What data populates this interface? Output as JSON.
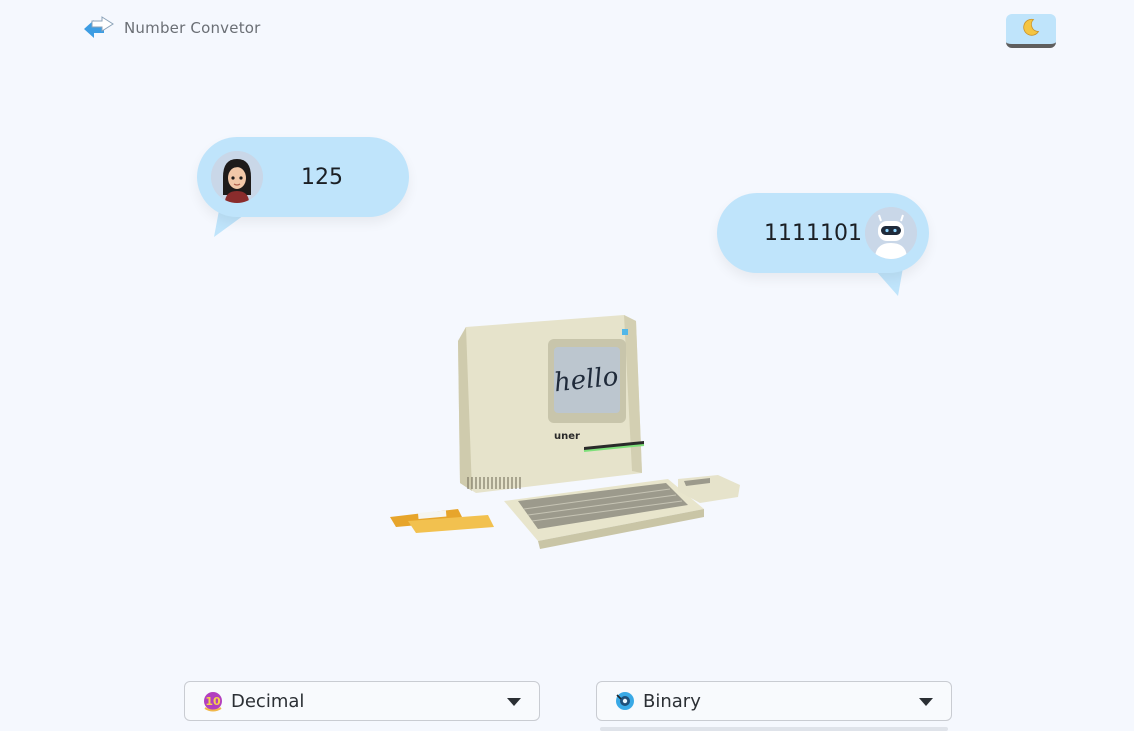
{
  "app": {
    "title": "Number Convetor",
    "logo_icon": "swap-arrows-icon",
    "theme_toggle_icon": "moon-icon"
  },
  "conversation": {
    "user_message": "125",
    "bot_message": "1111101",
    "user_avatar": "woman-avatar-icon",
    "bot_avatar": "robot-avatar-icon"
  },
  "illustration": {
    "screen_text": "hello",
    "brand_text": "uner"
  },
  "converter": {
    "from": {
      "label": "Decimal",
      "icon": "decimal-base-icon"
    },
    "to": {
      "label": "Binary",
      "icon": "binary-base-icon"
    }
  },
  "colors": {
    "bubble": "#bfe4fb",
    "background": "#f5f8fe",
    "accent": "#4a9ee0"
  }
}
